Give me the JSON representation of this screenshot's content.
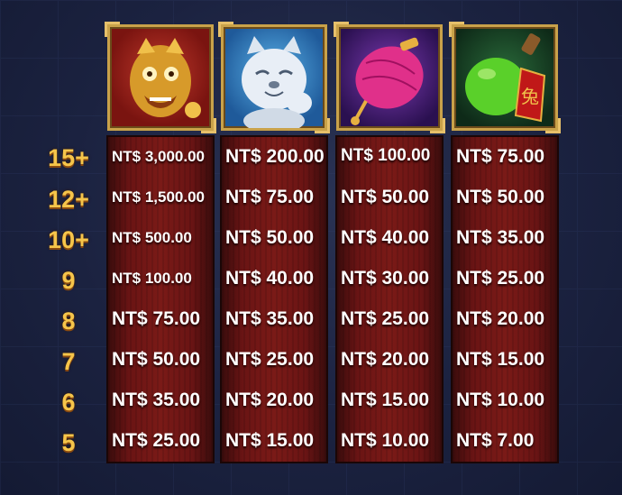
{
  "symbols": [
    {
      "name": "golden-lion-icon"
    },
    {
      "name": "lucky-cat-icon"
    },
    {
      "name": "pink-lantern-icon"
    },
    {
      "name": "green-potion-icon",
      "label": "兔"
    }
  ],
  "counts": [
    "15+",
    "12+",
    "10+",
    "9",
    "8",
    "7",
    "6",
    "5"
  ],
  "paytable": [
    [
      "NT$ 3,000.00",
      "NT$ 1,500.00",
      "NT$ 500.00",
      "NT$ 100.00",
      "NT$ 75.00",
      "NT$ 50.00",
      "NT$ 35.00",
      "NT$ 25.00"
    ],
    [
      "NT$ 200.00",
      "NT$ 75.00",
      "NT$ 50.00",
      "NT$ 40.00",
      "NT$ 35.00",
      "NT$ 25.00",
      "NT$ 20.00",
      "NT$ 15.00"
    ],
    [
      "NT$ 100.00",
      "NT$ 50.00",
      "NT$ 40.00",
      "NT$ 30.00",
      "NT$ 25.00",
      "NT$ 20.00",
      "NT$ 15.00",
      "NT$ 10.00"
    ],
    [
      "NT$ 75.00",
      "NT$ 50.00",
      "NT$ 35.00",
      "NT$ 25.00",
      "NT$ 20.00",
      "NT$ 15.00",
      "NT$ 10.00",
      "NT$ 7.00"
    ]
  ],
  "colors": {
    "gold": "#f6c54a",
    "column_red": "#7a1a17",
    "background": "#1b2240"
  }
}
